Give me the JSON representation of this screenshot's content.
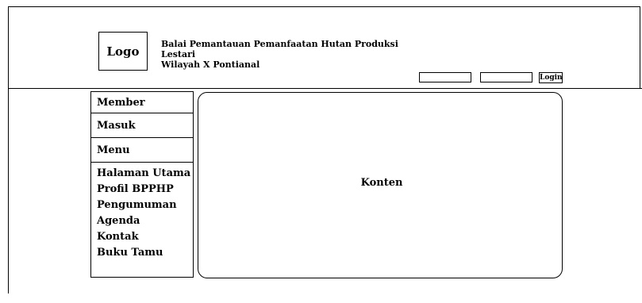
{
  "header": {
    "logo_text": "Logo",
    "site_title": "Balai Pemantauan Pemanfaatan Hutan Produksi Lestari\nWilayah X Pontianal",
    "login": {
      "username_value": "",
      "password_value": "",
      "button_label": "Login"
    }
  },
  "sidebar": {
    "member_label": "Member",
    "masuk_label": "Masuk",
    "menu_label": "Menu",
    "nav_items": [
      "Halaman Utama",
      "Profil BPPHP",
      "Pengumuman",
      "Agenda",
      "Kontak",
      "Buku Tamu"
    ]
  },
  "main": {
    "content_label": "Konten"
  }
}
